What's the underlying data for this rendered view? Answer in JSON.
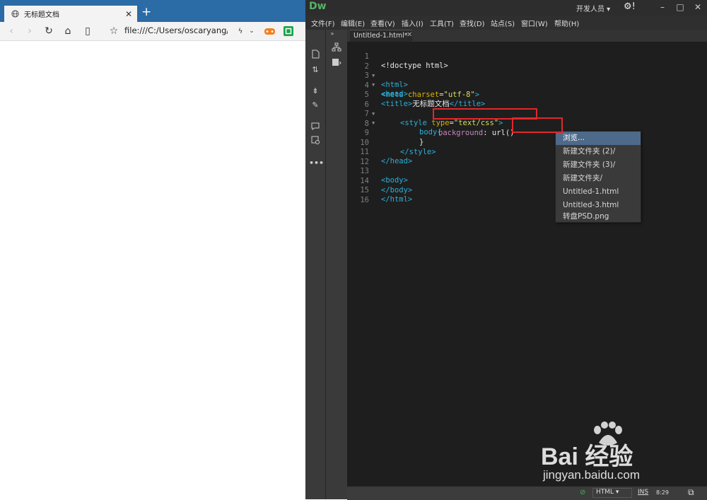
{
  "browser": {
    "tab_title": "无标题文档",
    "address": "file:///C:/Users/oscaryang/De"
  },
  "dw": {
    "logo": "Dw",
    "workspace": "开发人员",
    "menu": [
      "文件(F)",
      "编辑(E)",
      "查看(V)",
      "插入(I)",
      "工具(T)",
      "查找(D)",
      "站点(S)",
      "窗口(W)",
      "帮助(H)"
    ],
    "doc_tab": "Untitled-1.html*",
    "line_numbers": [
      "1",
      "2",
      "3",
      "4",
      "5",
      "6",
      "7",
      "8",
      "9",
      "10",
      "11",
      "12",
      "13",
      "14",
      "15",
      "16"
    ],
    "code": {
      "l1": "<!doctype html>",
      "l2": "<html>",
      "l3": "<head>",
      "l4_tag": "<meta ",
      "l4_attr": "charset",
      "l4_eq": "=",
      "l4_val": "\"utf-8\"",
      "l4_end": ">",
      "l5_open": "<title>",
      "l5_text": "无标题文档",
      "l5_close": "</title>",
      "l6_tag": "<style ",
      "l6_attr": "type",
      "l6_eq": "=",
      "l6_val": "\"text/css\"",
      "l6_end": ">",
      "l7": "body{",
      "l8_prop": "background",
      "l8_colon": ": ",
      "l8_val": "url()",
      "l9": "}",
      "l10": "</style>",
      "l11": "</head>",
      "l13": "<body>",
      "l14": "</body>",
      "l15": "</html>"
    },
    "autocomplete": [
      "浏览...",
      "新建文件夹 (2)/",
      "新建文件夹 (3)/",
      "新建文件夹/",
      "Untitled-1.html",
      "Untitled-3.html",
      "转盘PSD.png"
    ],
    "status": {
      "doc_type": "HTML",
      "mode": "INS",
      "position": "8:29"
    }
  },
  "watermark": {
    "brand": "Bai 经验",
    "url": "jingyan.baidu.com"
  },
  "colors": {
    "browser_tabstrip": "#2b6ba6",
    "dw_bg": "#323232",
    "editor_bg": "#1e1e1e",
    "highlight_red": "#e0282a",
    "selected_item": "#4e6a8a"
  }
}
